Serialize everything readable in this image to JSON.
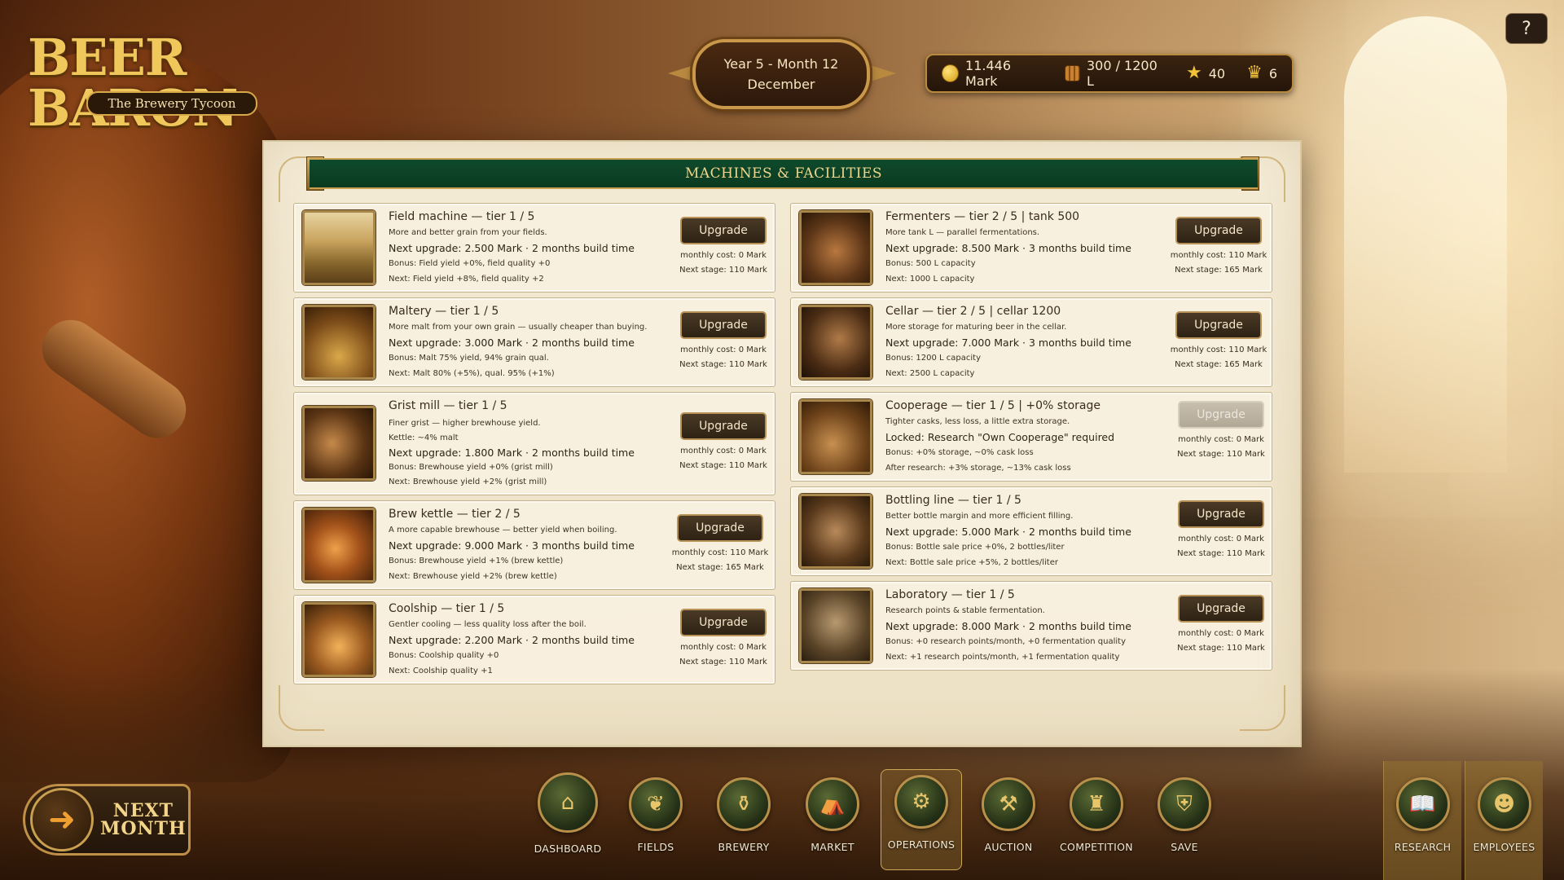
{
  "logo": {
    "title": "BEER BARON",
    "subtitle": "The Brewery Tycoon"
  },
  "date": {
    "line1": "Year 5 - Month 12",
    "line2": "December"
  },
  "resources": {
    "money": "11.446 Mark",
    "storage": "300 / 1200 L",
    "stars": "40",
    "crowns": "6"
  },
  "help": {
    "label": "?"
  },
  "panel": {
    "title": "MACHINES & FACILITIES"
  },
  "machines": [
    {
      "title": "Field machine — tier 1 / 5",
      "lines": [
        "More and better grain from your fields."
      ],
      "next_upgrade": "Next upgrade: 2.500 Mark · 2 months build time",
      "bonus": "Bonus: Field yield +0%, field quality +0",
      "next": "Next: Field yield +8%, field quality +2",
      "button": "Upgrade",
      "monthly": "monthly cost: 0 Mark",
      "next_stage": "Next stage: 110 Mark",
      "icon": "tractor-icon"
    },
    {
      "title": "Maltery — tier 1 / 5",
      "lines": [
        "More malt from your own grain — usually cheaper than buying."
      ],
      "next_upgrade": "Next upgrade: 3.000 Mark · 2 months build time",
      "bonus": "Bonus: Malt 75% yield, 94% grain qual.",
      "next": "Next: Malt 80% (+5%), qual. 95% (+1%)",
      "button": "Upgrade",
      "monthly": "monthly cost: 0 Mark",
      "next_stage": "Next stage: 110 Mark",
      "icon": "malt-icon"
    },
    {
      "title": "Grist mill — tier 1 / 5",
      "lines": [
        "Finer grist — higher brewhouse yield.",
        "Kettle: ~4% malt"
      ],
      "next_upgrade": "Next upgrade: 1.800 Mark · 2 months build time",
      "bonus": "Bonus: Brewhouse yield +0% (grist mill)",
      "next": "Next: Brewhouse yield +2% (grist mill)",
      "button": "Upgrade",
      "monthly": "monthly cost: 0 Mark",
      "next_stage": "Next stage: 110 Mark",
      "icon": "mill-icon"
    },
    {
      "title": "Brew kettle — tier 2 / 5",
      "lines": [
        "A more capable brewhouse — better yield when boiling."
      ],
      "next_upgrade": "Next upgrade: 9.000 Mark · 3 months build time",
      "bonus": "Bonus: Brewhouse yield +1% (brew kettle)",
      "next": "Next: Brewhouse yield +2% (brew kettle)",
      "button": "Upgrade",
      "monthly": "monthly cost: 110 Mark",
      "next_stage": "Next stage: 165 Mark",
      "icon": "kettle-icon"
    },
    {
      "title": "Coolship — tier 1 / 5",
      "lines": [
        "Gentler cooling — less quality loss after the boil."
      ],
      "next_upgrade": "Next upgrade: 2.200 Mark · 2 months build time",
      "bonus": "Bonus: Coolship quality +0",
      "next": "Next: Coolship quality +1",
      "button": "Upgrade",
      "monthly": "monthly cost: 0 Mark",
      "next_stage": "Next stage: 110 Mark",
      "icon": "coolship-icon"
    },
    {
      "title": "Fermenters — tier 2 / 5 | tank 500",
      "lines": [
        "More tank L — parallel fermentations."
      ],
      "next_upgrade": "Next upgrade: 8.500 Mark · 3 months build time",
      "bonus": "Bonus: 500 L capacity",
      "next": "Next: 1000 L capacity",
      "button": "Upgrade",
      "monthly": "monthly cost: 110 Mark",
      "next_stage": "Next stage: 165 Mark",
      "icon": "fermenter-icon"
    },
    {
      "title": "Cellar — tier 2 / 5 | cellar 1200",
      "lines": [
        "More storage for maturing beer in the cellar."
      ],
      "next_upgrade": "Next upgrade: 7.000 Mark · 3 months build time",
      "bonus": "Bonus: 1200 L capacity",
      "next": "Next: 2500 L capacity",
      "button": "Upgrade",
      "monthly": "monthly cost: 110 Mark",
      "next_stage": "Next stage: 165 Mark",
      "icon": "cellar-icon"
    },
    {
      "title": "Cooperage — tier 1 / 5 | +0% storage",
      "lines": [
        "Tighter casks, less loss, a little extra storage."
      ],
      "next_upgrade": "Locked: Research \"Own Cooperage\" required",
      "bonus": "Bonus: +0% storage, ~0% cask loss",
      "next": "After research: +3% storage, ~13% cask loss",
      "button": "Upgrade",
      "monthly": "monthly cost: 0 Mark",
      "next_stage": "Next stage: 110 Mark",
      "icon": "cask-icon"
    },
    {
      "title": "Bottling line — tier 1 / 5",
      "lines": [
        "Better bottle margin and more efficient filling."
      ],
      "next_upgrade": "Next upgrade: 5.000 Mark · 2 months build time",
      "bonus": "Bonus: Bottle sale price +0%, 2 bottles/liter",
      "next": "Next: Bottle sale price +5%, 2 bottles/liter",
      "button": "Upgrade",
      "monthly": "monthly cost: 0 Mark",
      "next_stage": "Next stage: 110 Mark",
      "icon": "bottle-icon"
    },
    {
      "title": "Laboratory — tier 1 / 5",
      "lines": [
        "Research points & stable fermentation."
      ],
      "next_upgrade": "Next upgrade: 8.000 Mark · 2 months build time",
      "bonus": "Bonus: +0 research points/month, +0 fermentation quality",
      "next": "Next: +1 research points/month, +1 fermentation quality",
      "button": "Upgrade",
      "monthly": "monthly cost: 0 Mark",
      "next_stage": "Next stage: 110 Mark",
      "icon": "flask-icon"
    }
  ],
  "next_month": {
    "line1": "NEXT",
    "line2": "MONTH"
  },
  "nav": [
    "DASHBOARD",
    "FIELDS",
    "BREWERY",
    "MARKET",
    "OPERATIONS",
    "AUCTION",
    "COMPETITION",
    "SAVE"
  ],
  "side_nav": [
    "RESEARCH",
    "EMPLOYEES"
  ]
}
